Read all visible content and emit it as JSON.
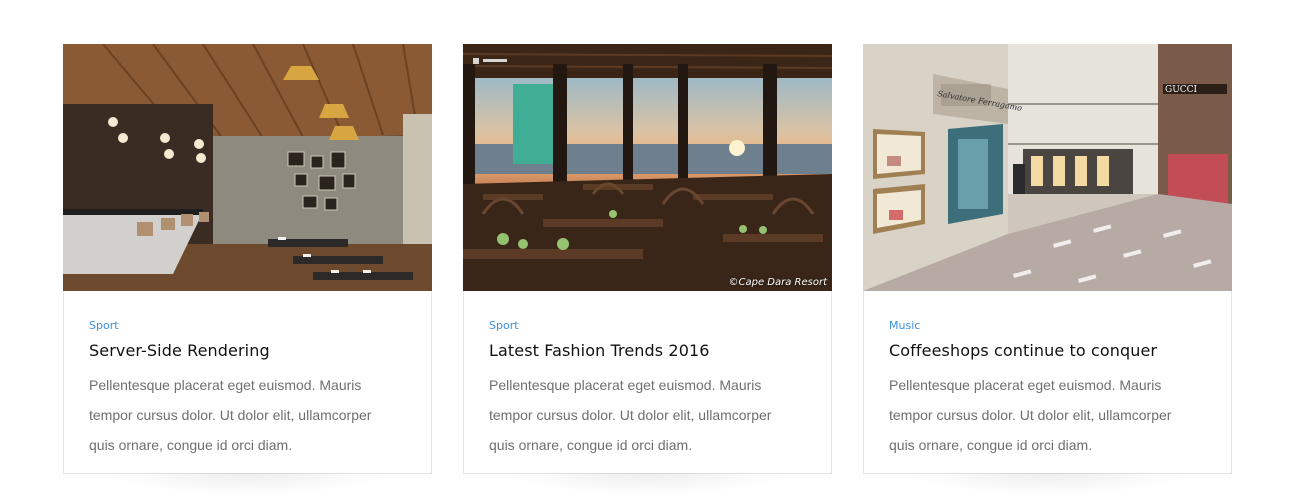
{
  "cards": [
    {
      "category": "Sport",
      "title": "Server-Side Rendering",
      "excerpt": "Pellentesque placerat eget euismod. Mauris tempor cursus dolor. Ut dolor elit, ullamcorper quis ornare, congue id orci diam."
    },
    {
      "category": "Sport",
      "title": "Latest Fashion Trends 2016",
      "excerpt": "Pellentesque placerat eget euismod. Mauris tempor cursus dolor. Ut dolor elit, ullamcorper quis ornare, congue id orci diam.",
      "image_watermark": "©Cape Dara Resort"
    },
    {
      "category": "Music",
      "title": "Coffeeshops continue to conquer",
      "excerpt": "Pellentesque placerat eget euismod. Mauris tempor cursus dolor. Ut dolor elit, ullamcorper quis ornare, congue id orci diam.",
      "image_signs": [
        "Salvatore Ferragamo",
        "GUCCI"
      ]
    }
  ],
  "colors": {
    "category_link": "#3d8fe0",
    "title": "#111111",
    "excerpt": "#6f6f6f",
    "card_border": "#e6e6e6"
  }
}
